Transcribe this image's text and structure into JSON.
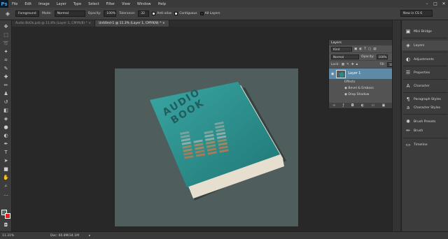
{
  "app": {
    "logo": "Ps"
  },
  "menu": [
    "File",
    "Edit",
    "Image",
    "Layer",
    "Type",
    "Select",
    "Filter",
    "View",
    "Window",
    "Help"
  ],
  "options": {
    "source": "Foreground",
    "mode_label": "Mode:",
    "mode_value": "Normal",
    "opacity_label": "Opacity:",
    "opacity_value": "100%",
    "tolerance_label": "Tolerance:",
    "tolerance_value": "32",
    "antialias_label": "Anti-alias",
    "contiguous_label": "Contiguous",
    "all_layers_label": "All Layers",
    "workspace": "New in CS 6"
  },
  "tabs": [
    {
      "label": "Audio BoOk.psb @ 11.8% (Layer 1, CMYK/8) *"
    },
    {
      "label": "Untitled-1 @ 11.3% (Layer 1, CMYK/8) *"
    }
  ],
  "book": {
    "title_line1": "AUDIO",
    "title_line2": "BOOK",
    "colors": {
      "canvas": "#4f5e5d",
      "cover": "#2a8c8a",
      "spine": "#1e6d6b",
      "pages": "#e6dfcf"
    }
  },
  "status": {
    "zoom": "11.31%",
    "doc": "Doc: 60.8M/34.1M"
  },
  "layers_panel": {
    "title": "Layers",
    "kind": "Kind",
    "blend": "Normal",
    "opacity_label": "Opacity:",
    "opacity_value": "100%",
    "lock_label": "Lock:",
    "fill_label": "Fill:",
    "fill_value": "100%",
    "layer_name": "Layer 1",
    "fx": "fx",
    "effects": "Effects",
    "effect1": "Bevel & Emboss",
    "effect2": "Drop Shadow"
  },
  "dock": [
    {
      "label": "Mini Bridge",
      "icon": "mini-bridge-icon"
    },
    {
      "label": "Layers",
      "icon": "layers-icon"
    },
    {
      "label": "Adjustments",
      "icon": "adjustments-icon"
    },
    {
      "label": "Properties",
      "icon": "properties-icon"
    },
    {
      "label": "Character",
      "icon": "character-icon"
    },
    {
      "label": "Paragraph Styles",
      "icon": "paragraph-styles-icon"
    },
    {
      "label": "Character Styles",
      "icon": "character-styles-icon"
    },
    {
      "label": "Brush Presets",
      "icon": "brush-presets-icon"
    },
    {
      "label": "Brush",
      "icon": "brush-icon"
    },
    {
      "label": "Timeline",
      "icon": "timeline-icon"
    }
  ]
}
